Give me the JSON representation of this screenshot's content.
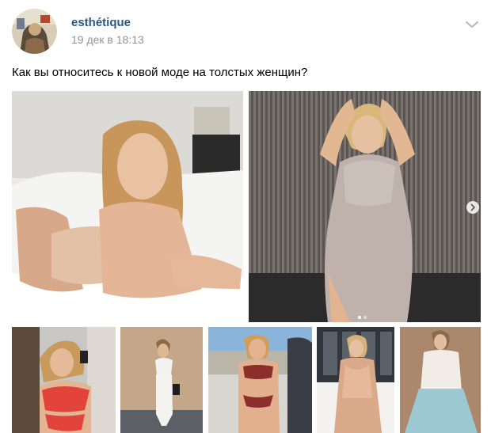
{
  "post": {
    "author_name": "esthétique",
    "date": "19 дек в 18:13",
    "text": "Как вы относитесь к новой моде на толстых женщин?",
    "menu_icon": "chevron-down-icon",
    "avatar_icon": "avatar-icon"
  },
  "photos": {
    "count": 7,
    "carousel": {
      "next_icon": "chevron-right-icon",
      "page_count": 2,
      "active_page": 1
    }
  },
  "colors": {
    "author_link": "#2a5885",
    "meta_text": "#939393",
    "body_text": "#000000",
    "chevron": "#aeb7c2"
  }
}
